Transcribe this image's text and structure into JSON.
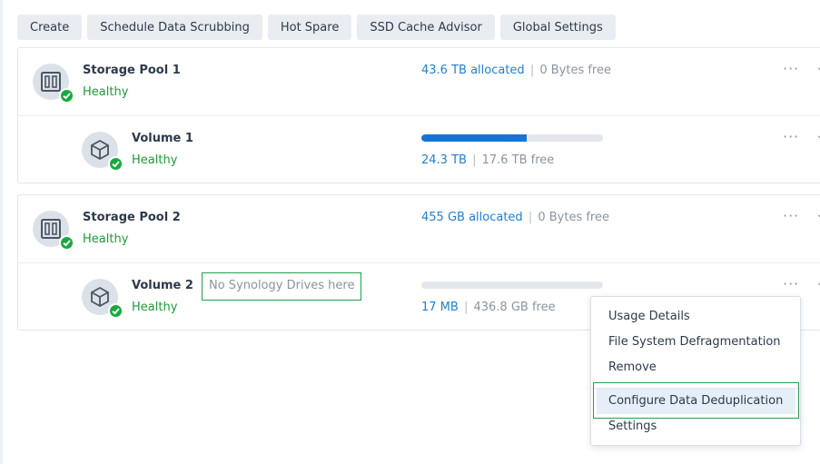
{
  "toolbar": {
    "buttons": [
      "Create",
      "Schedule Data Scrubbing",
      "Hot Spare",
      "SSD Cache Advisor",
      "Global Settings"
    ]
  },
  "pools": [
    {
      "name": "Storage Pool 1",
      "status": "Healthy",
      "allocated": "43.6 TB allocated",
      "free": "0 Bytes free",
      "volume": {
        "name": "Volume 1",
        "status": "Healthy",
        "used": "24.3 TB",
        "free": "17.6 TB free",
        "usage_fraction": 0.58
      }
    },
    {
      "name": "Storage Pool 2",
      "status": "Healthy",
      "allocated": "455 GB allocated",
      "free": "0 Bytes free",
      "volume": {
        "name": "Volume 2",
        "status": "Healthy",
        "used": "17 MB",
        "free": "436.8 GB free",
        "usage_fraction": 0.0,
        "note": "No Synology Drives here"
      }
    }
  ],
  "menu": {
    "items": [
      "Usage Details",
      "File System Defragmentation",
      "Remove",
      "Configure Data Deduplication",
      "Settings"
    ],
    "highlighted": "Configure Data Deduplication"
  },
  "icons": {
    "more": "more-horizontal-icon",
    "expand": "chevron-down-icon",
    "pool": "storage-pool-icon",
    "volume": "volume-cube-icon",
    "status": "healthy-check-icon"
  },
  "colors": {
    "healthy": "#1f9a35",
    "link": "#1f7fd1",
    "bar": "#1674d9",
    "highlight_frame": "#21a04a"
  }
}
